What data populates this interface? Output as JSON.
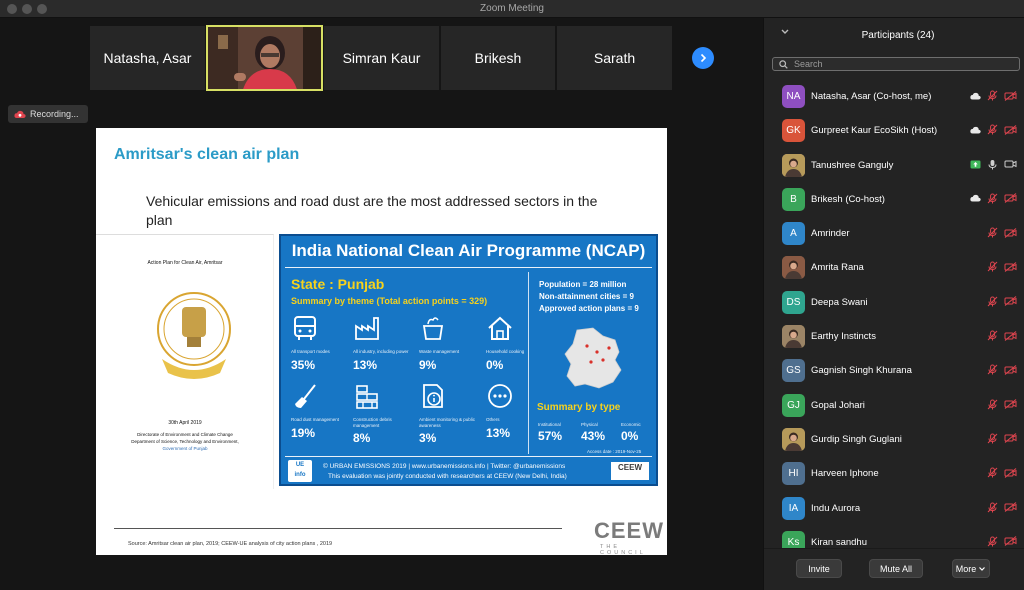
{
  "window": {
    "title": "Zoom Meeting"
  },
  "tiles": [
    {
      "name": "Natasha, Asar"
    },
    {
      "name": "Simran Kaur"
    },
    {
      "name": "Brikesh"
    },
    {
      "name": "Sarath"
    }
  ],
  "recording": {
    "label": "Recording..."
  },
  "slide": {
    "title": "Amritsar's clean air plan",
    "subtitle": "Vehicular emissions and road dust are the most addressed sectors in the plan",
    "left_panel": {
      "heading": "Action Plan for Clean Air, Amritsar",
      "date": "30th April 2019",
      "dept1": "Directorate of Environment and Climate Change",
      "dept2": "Department of Science, Technology and Environment,",
      "gov": "Government of Punjab"
    },
    "ncap": {
      "title": "India National Clean Air Programme (NCAP)",
      "state": "State : Punjab",
      "summary_theme": "Summary by theme (Total action points = 329)",
      "population": "Population = 28 million",
      "nonattainment": "Non-attainment cities = 9",
      "approved": "Approved action plans = 9",
      "themes": [
        {
          "label": "All transport modes",
          "pct": "35%"
        },
        {
          "label": "All industry, including power",
          "pct": "13%"
        },
        {
          "label": "Waste management",
          "pct": "9%"
        },
        {
          "label": "Household cooking",
          "pct": "0%"
        },
        {
          "label": "Road dust management",
          "pct": "19%"
        },
        {
          "label": "Construction debris management",
          "pct": "8%"
        },
        {
          "label": "Ambient monitoring & public awareness",
          "pct": "3%"
        },
        {
          "label": "Others",
          "pct": "13%"
        }
      ],
      "summary_type": "Summary by type",
      "types": [
        {
          "label": "Institutional",
          "pct": "57%"
        },
        {
          "label": "Physical",
          "pct": "43%"
        },
        {
          "label": "Economic",
          "pct": "0%"
        }
      ],
      "access_date": "Access date : 2019-Nov-25",
      "ue_logo_1": "UE",
      "ue_logo_2": "info",
      "footer1": "© URBAN EMISSIONS 2019 | www.urbanemissions.info | Twitter: @urbanemissions",
      "footer2": "This evaluation was jointly conducted with researchers at CEEW (New Delhi, India)",
      "ceew_small": "CEEW"
    },
    "source": "Source: Amritsar clean air plan, 2019; CEEW-UE analysis of city action plans , 2019",
    "logo_text": "CEEW",
    "logo_sub": "THE COUNCIL"
  },
  "panel": {
    "title": "Participants (24)",
    "search_placeholder": "Search",
    "participants": [
      {
        "initials": "NA",
        "name": "Natasha, Asar (Co-host, me)",
        "color": "#8e4fc0"
      },
      {
        "initials": "GK",
        "name": "Gurpreet Kaur EcoSikh (Host)",
        "color": "#d9543a"
      },
      {
        "initials": "",
        "name": "Tanushree Ganguly",
        "color": "#c7a48a"
      },
      {
        "initials": "B",
        "name": "Brikesh (Co-host)",
        "color": "#3aa55a"
      },
      {
        "initials": "A",
        "name": "Amrinder",
        "color": "#2f86c9"
      },
      {
        "initials": "",
        "name": "Amrita Rana",
        "color": "#7a5a4a"
      },
      {
        "initials": "DS",
        "name": "Deepa Swani",
        "color": "#2fa58f"
      },
      {
        "initials": "",
        "name": "Earthy Instincts",
        "color": "#a08a3a"
      },
      {
        "initials": "GS",
        "name": "Gagnish Singh Khurana",
        "color": "#4f6f8f"
      },
      {
        "initials": "GJ",
        "name": "Gopal Johari",
        "color": "#3aa55a"
      },
      {
        "initials": "",
        "name": "Gurdip Singh Guglani",
        "color": "#8a7a5a"
      },
      {
        "initials": "HI",
        "name": "Harveen  Iphone",
        "color": "#4f6f8f"
      },
      {
        "initials": "IA",
        "name": "Indu Aurora",
        "color": "#2f86c9"
      },
      {
        "initials": "Ks",
        "name": "Kiran sandhu",
        "color": "#3aa55a"
      }
    ],
    "invite_label": "Invite",
    "mute_all_label": "Mute All",
    "more_label": "More"
  }
}
